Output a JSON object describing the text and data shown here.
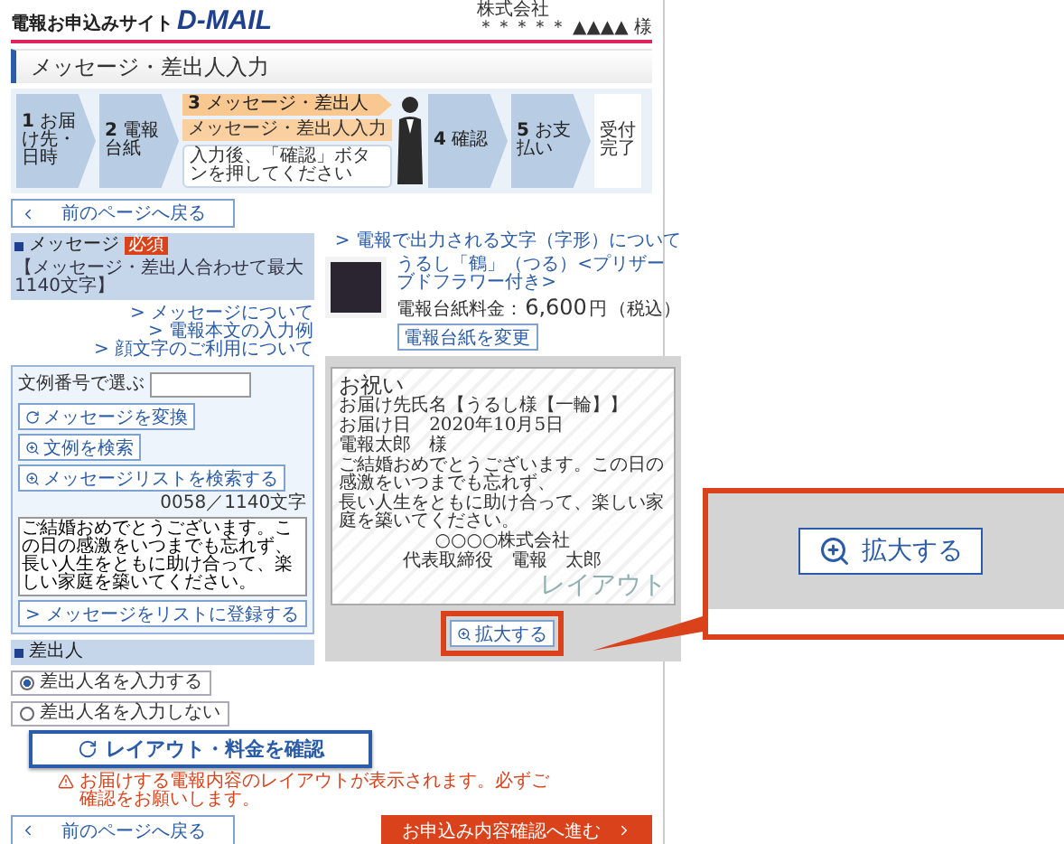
{
  "header": {
    "site_label": "電報お申込みサイト",
    "logo": "D-MAIL",
    "company": "株式会社",
    "user": "＊＊＊＊＊ ▲▲▲▲ 様"
  },
  "page_title": "メッセージ・差出人入力",
  "steps": [
    {
      "kind": "arrow",
      "number": "1",
      "label": "お届け先・日時",
      "selected": false
    },
    {
      "kind": "arrow",
      "number": "2",
      "label": "電報台紙",
      "selected": false
    },
    {
      "kind": "arrow",
      "number": "3",
      "label": "メッセージ・差出人",
      "sub_label": "メッセージ・差出人入力",
      "hint": "入力後、「確認」ボタンを押してください",
      "selected": true
    },
    {
      "kind": "arrow",
      "number": "4",
      "label": "確認",
      "selected": false
    },
    {
      "kind": "arrow",
      "number": "5",
      "label": "お支払い",
      "selected": false
    },
    {
      "kind": "end",
      "label": "受付完了",
      "selected": false
    }
  ],
  "back_button_top": "前のページへ戻る",
  "message_section": {
    "title": "メッセージ",
    "required_badge": "必須",
    "limit_note": "【メッセージ・差出人合わせて最大1140文字】",
    "links": [
      "> メッセージについて",
      "> 電報本文の入力例",
      "> 顔文字のご利用について"
    ],
    "lookup_label": "文例番号で選ぶ",
    "convert_button": "メッセージを変換",
    "search_button": "文例を検索",
    "list_search_button": "メッセージリストを検索する",
    "char_count": "0058／1140文字",
    "message": "ご結婚おめでとうございます。この日の感激をいつまでも忘れず、長い人生をともに助け合って、楽しい家庭を築いてください。",
    "register_button": "> メッセージをリストに登録する"
  },
  "sender_section": {
    "title": "差出人",
    "options": [
      {
        "label": "差出人名を入力する",
        "selected": true
      },
      {
        "label": "差出人名を入力しない",
        "selected": false
      }
    ]
  },
  "product": {
    "font_link": "> 電報で出力される文字（字形）について",
    "name": "うるし「鶴」（つる）<プリザーブドフラワー付き>",
    "price_label": "電報台紙料金：",
    "price": "6,600",
    "price_unit": "円",
    "tax_note": "（税込）",
    "change_button": "電報台紙を変更"
  },
  "preview": {
    "heading": "お祝い",
    "recipient_line": "お届け先氏名【うるし様【一輪】】",
    "date_line": "お届け日　2020年10月5日",
    "addressee": "電報太郎　様",
    "body": [
      "ご結婚おめでとうございます。この日の感激をいつまでも忘れず、",
      "長い人生をともに助け合って、楽しい家庭を築いてください。"
    ],
    "company": "○○○○株式会社",
    "signer": "代表取締役　電報　太郎",
    "watermark": "レイアウト",
    "zoom_button": "拡大する"
  },
  "confirm": {
    "button": "レイアウト・料金を確認",
    "warning": "お届けする電報内容のレイアウトが表示されます。必ずご確認をお願いします。"
  },
  "footer": {
    "back_button": "前のページへ戻る",
    "next_button": "お申込み内容確認へ進む"
  },
  "callout": {
    "zoom_button": "拡大する"
  }
}
